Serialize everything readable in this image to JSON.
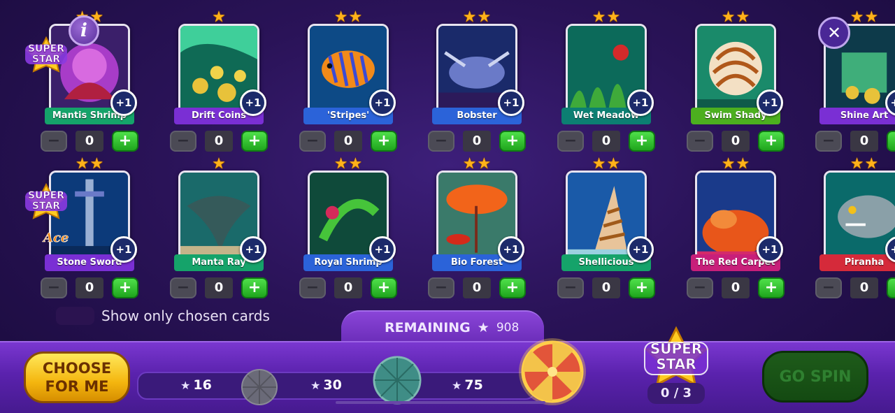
{
  "header": {
    "info_label": "i",
    "close_label": "✕"
  },
  "super_star_badge_label": "SUPER STAR",
  "ace_label": "Ace",
  "colors": {
    "star": "#ffb21a",
    "plus_button": "#2bbd28",
    "minus_button": "#4b4a55",
    "ribbon_green": "#15a36a",
    "ribbon_purple": "#7a2fd4",
    "ribbon_blue": "#2b63d9",
    "ribbon_teal": "#0c7f72",
    "ribbon_lime": "#4caf1f",
    "ribbon_pink": "#c81f7a",
    "ribbon_red": "#d52a3a"
  },
  "cards": [
    {
      "name": "Mantis Shrimp",
      "stars": 2,
      "bonus": "+1",
      "count": "0",
      "super_star": true,
      "ribbon": "green",
      "art": "mantis"
    },
    {
      "name": "Drift Coins",
      "stars": 1,
      "bonus": "+1",
      "count": "0",
      "super_star": false,
      "ribbon": "purple",
      "art": "coins"
    },
    {
      "name": "'Stripes'",
      "stars": 2,
      "bonus": "+1",
      "count": "0",
      "super_star": false,
      "ribbon": "blue",
      "art": "fish"
    },
    {
      "name": "Bobster",
      "stars": 2,
      "bonus": "+1",
      "count": "0",
      "super_star": false,
      "ribbon": "blue",
      "art": "lobster"
    },
    {
      "name": "Wet Meadow",
      "stars": 2,
      "bonus": "+1",
      "count": "0",
      "super_star": false,
      "ribbon": "teal",
      "art": "meadow"
    },
    {
      "name": "Swim Shady",
      "stars": 2,
      "bonus": "+1",
      "count": "0",
      "super_star": false,
      "ribbon": "lime",
      "art": "nautilus"
    },
    {
      "name": "Shine Art",
      "stars": 2,
      "bonus": "+1",
      "count": "0",
      "super_star": false,
      "ribbon": "purple",
      "art": "treasure"
    },
    {
      "name": "Stone Sword",
      "stars": 2,
      "bonus": "+1",
      "count": "0",
      "super_star": true,
      "ribbon": "purple",
      "art": "sword"
    },
    {
      "name": "Manta Ray",
      "stars": 1,
      "bonus": "+1",
      "count": "0",
      "super_star": false,
      "ribbon": "green",
      "art": "ray"
    },
    {
      "name": "Royal Shrimp",
      "stars": 2,
      "bonus": "+1",
      "count": "0",
      "super_star": false,
      "ribbon": "blue",
      "art": "royal"
    },
    {
      "name": "Bio Forest",
      "stars": 2,
      "bonus": "+1",
      "count": "0",
      "super_star": false,
      "ribbon": "blue",
      "art": "forest"
    },
    {
      "name": "Shellicious",
      "stars": 2,
      "bonus": "+1",
      "count": "0",
      "super_star": false,
      "ribbon": "green",
      "art": "shell"
    },
    {
      "name": "The Red Carpet",
      "stars": 2,
      "bonus": "+1",
      "count": "0",
      "super_star": false,
      "ribbon": "pink",
      "art": "coral"
    },
    {
      "name": "Piranha",
      "stars": 2,
      "bonus": "+1",
      "count": "0",
      "super_star": false,
      "ribbon": "red",
      "art": "piranha"
    }
  ],
  "filter": {
    "label": "Show only chosen cards"
  },
  "remaining": {
    "label": "REMAINING",
    "value": "908"
  },
  "choose_button": {
    "line1": "CHOOSE",
    "line2": "FOR ME"
  },
  "milestones": [
    {
      "value": "16"
    },
    {
      "value": "30"
    },
    {
      "value": "75"
    }
  ],
  "super_star_counter": {
    "label_line1": "SUPER",
    "label_line2": "STAR",
    "value": "0 / 3"
  },
  "go_spin_button": {
    "label": "GO SPIN"
  }
}
